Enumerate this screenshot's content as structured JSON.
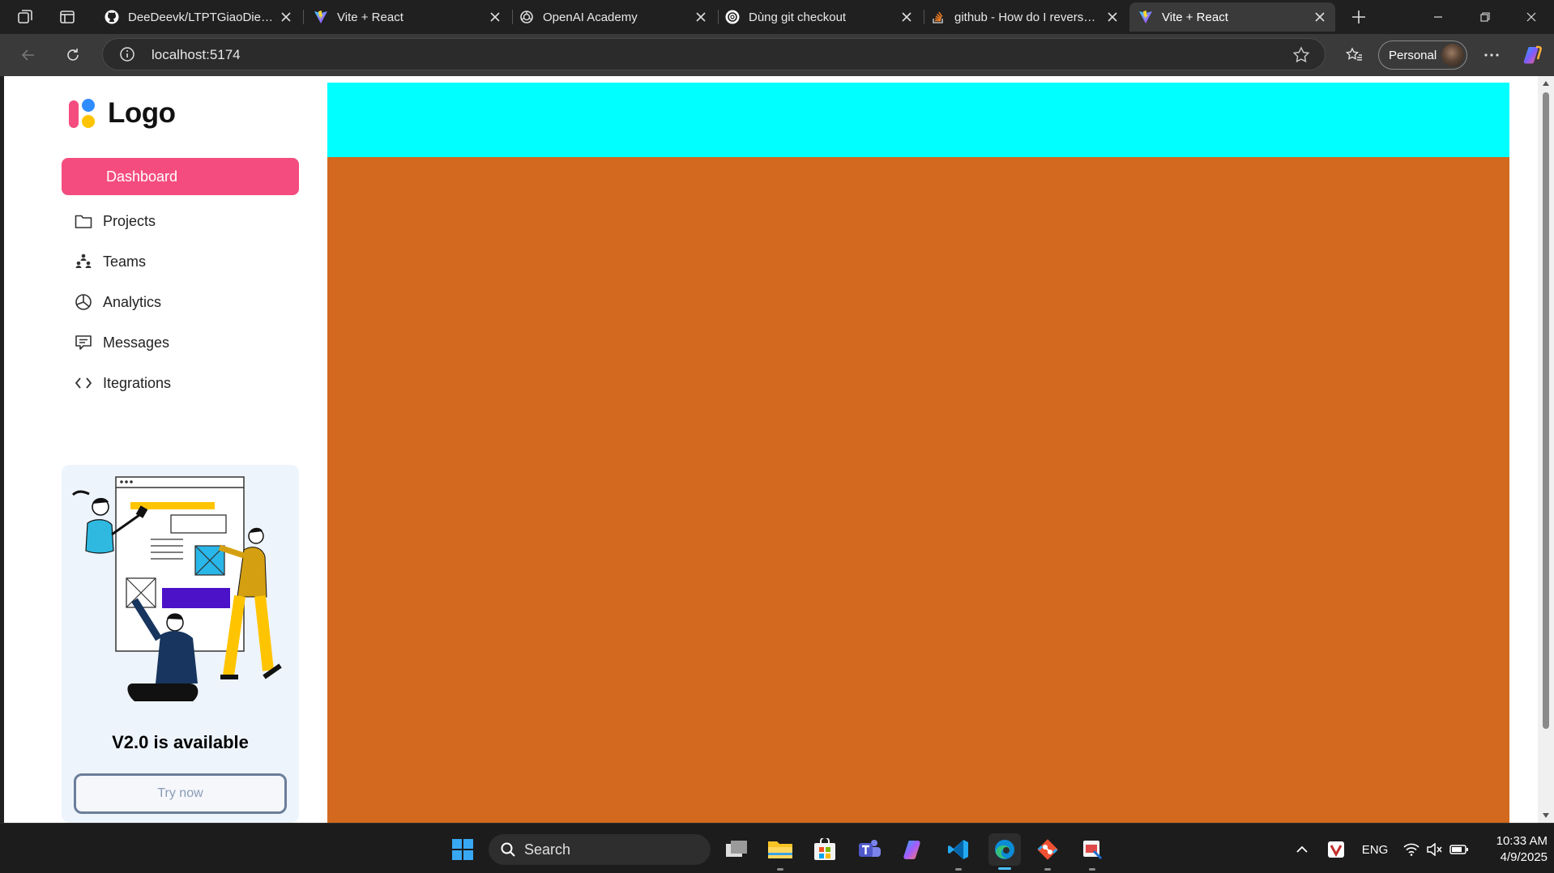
{
  "browser": {
    "tabs": [
      {
        "title": "DeeDeevk/LTPTGiaoDien_N",
        "favicon": "github-icon"
      },
      {
        "title": "Vite + React",
        "favicon": "vite-icon"
      },
      {
        "title": "OpenAI Academy",
        "favicon": "openai-icon"
      },
      {
        "title": "Dùng git checkout",
        "favicon": "chatgpt-icon"
      },
      {
        "title": "github - How do I reverse a",
        "favicon": "stackoverflow-icon"
      },
      {
        "title": "Vite + React",
        "favicon": "vite-icon",
        "active": true
      }
    ],
    "url": "localhost:5174",
    "profile_label": "Personal"
  },
  "app": {
    "logo_text": "Logo",
    "nav": {
      "dashboard": "Dashboard",
      "projects": "Projects",
      "teams": "Teams",
      "analytics": "Analytics",
      "messages": "Messages",
      "integrations": "Itegrations"
    },
    "promo": {
      "title": "V2.0 is available",
      "button": "Try now"
    },
    "colors": {
      "accent": "#f44c7f",
      "header": "#00ffff",
      "main": "#d2691e"
    }
  },
  "taskbar": {
    "search_label": "Search",
    "language": "ENG",
    "time": "10:33 AM",
    "date": "4/9/2025"
  }
}
